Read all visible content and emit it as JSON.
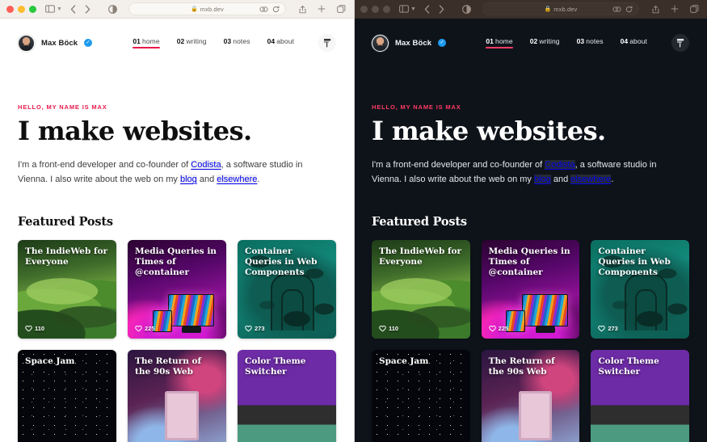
{
  "browser": {
    "url": "mxb.dev",
    "lock_icon": "lock-icon",
    "sidebar_icon": "sidebar-toggle-icon",
    "back_icon": "back-arrow-icon",
    "forward_icon": "forward-arrow-icon",
    "contrast_icon": "reader-contrast-icon",
    "extensions_icon": "extensions-icon",
    "reload_icon": "reload-icon",
    "share_icon": "share-icon",
    "new_tab_icon": "plus-icon",
    "tab_overview_icon": "tab-overview-icon"
  },
  "site": {
    "brand_name": "Max Böck",
    "verified_badge": "✓",
    "theme_button_icon": "theme-switcher-icon",
    "nav": [
      {
        "num": "01",
        "label": "home",
        "active": true
      },
      {
        "num": "02",
        "label": "writing",
        "active": false
      },
      {
        "num": "03",
        "label": "notes",
        "active": false
      },
      {
        "num": "04",
        "label": "about",
        "active": false
      }
    ],
    "hero": {
      "eyebrow": "HELLO, MY NAME IS MAX",
      "title": "I make websites.",
      "text_part1": "I'm a front-end developer and co-founder of ",
      "link_codista": "Codista",
      "text_part2": ", a software studio in Vienna. I also write about the web on my ",
      "link_blog": "blog",
      "text_part3": " and ",
      "link_elsewhere": "elsewhere",
      "text_part4": "."
    },
    "featured_heading": "Featured Posts",
    "cards": [
      {
        "title": "The IndieWeb for Everyone",
        "likes": "110",
        "art": "art-hills"
      },
      {
        "title": "Media Queries in Times of @container",
        "likes": "225",
        "art": "art-monitor"
      },
      {
        "title": "Container Queries in Web Components",
        "likes": "273",
        "art": "art-container"
      },
      {
        "title": "Space Jam",
        "likes": "",
        "art": "art-space"
      },
      {
        "title": "The Return of the 90s Web",
        "likes": "",
        "art": "art-retro"
      },
      {
        "title": "Color Theme Switcher",
        "likes": "",
        "art": "art-theme"
      }
    ]
  },
  "colors": {
    "accent_light": "#e8194b",
    "accent_dark": "#ff3b63",
    "light_bg": "#ffffff",
    "dark_bg": "#0e131a",
    "light_toolbar": "#f3f0ec",
    "dark_toolbar": "#3a2f29",
    "verified_blue": "#1d9bf0"
  }
}
